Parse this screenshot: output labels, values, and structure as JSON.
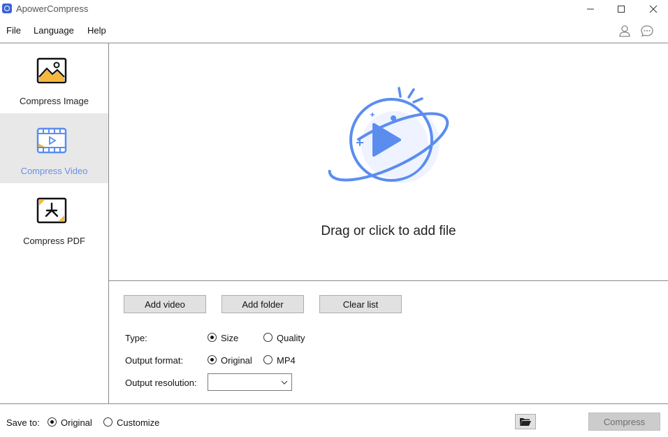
{
  "window": {
    "title": "ApowerCompress",
    "minimize_glyph": "—",
    "maximize_glyph": "☐",
    "close_glyph": "✕"
  },
  "menu": {
    "file": "File",
    "language": "Language",
    "help": "Help"
  },
  "header_icons": [
    "user-icon",
    "chat-icon"
  ],
  "sidebar": {
    "items": [
      {
        "label": "Compress Image",
        "icon": "image-icon",
        "active": false
      },
      {
        "label": "Compress Video",
        "icon": "video-icon",
        "active": true
      },
      {
        "label": "Compress PDF",
        "icon": "pdf-icon",
        "active": false
      }
    ]
  },
  "dropzone": {
    "text": "Drag or click to add file",
    "icon": "planet-play-icon"
  },
  "buttons": {
    "add_video": "Add video",
    "add_folder": "Add folder",
    "clear_list": "Clear list"
  },
  "options": {
    "type_label": "Type:",
    "type_options": [
      {
        "label": "Size",
        "checked": true
      },
      {
        "label": "Quality",
        "checked": false
      }
    ],
    "format_label": "Output format:",
    "format_options": [
      {
        "label": "Original",
        "checked": true
      },
      {
        "label": "MP4",
        "checked": false
      }
    ],
    "resolution_label": "Output resolution:",
    "resolution_value": ""
  },
  "footer": {
    "save_to_label": "Save to:",
    "save_options": [
      {
        "label": "Original",
        "checked": true
      },
      {
        "label": "Customize",
        "checked": false
      }
    ],
    "folder_icon": "folder-open-icon",
    "compress_label": "Compress"
  },
  "colors": {
    "accent": "#5b8def",
    "active_sidebar_bg": "#e8e8e8",
    "active_sidebar_text": "#6b8fe8",
    "icon_yellow": "#f6b73c"
  }
}
